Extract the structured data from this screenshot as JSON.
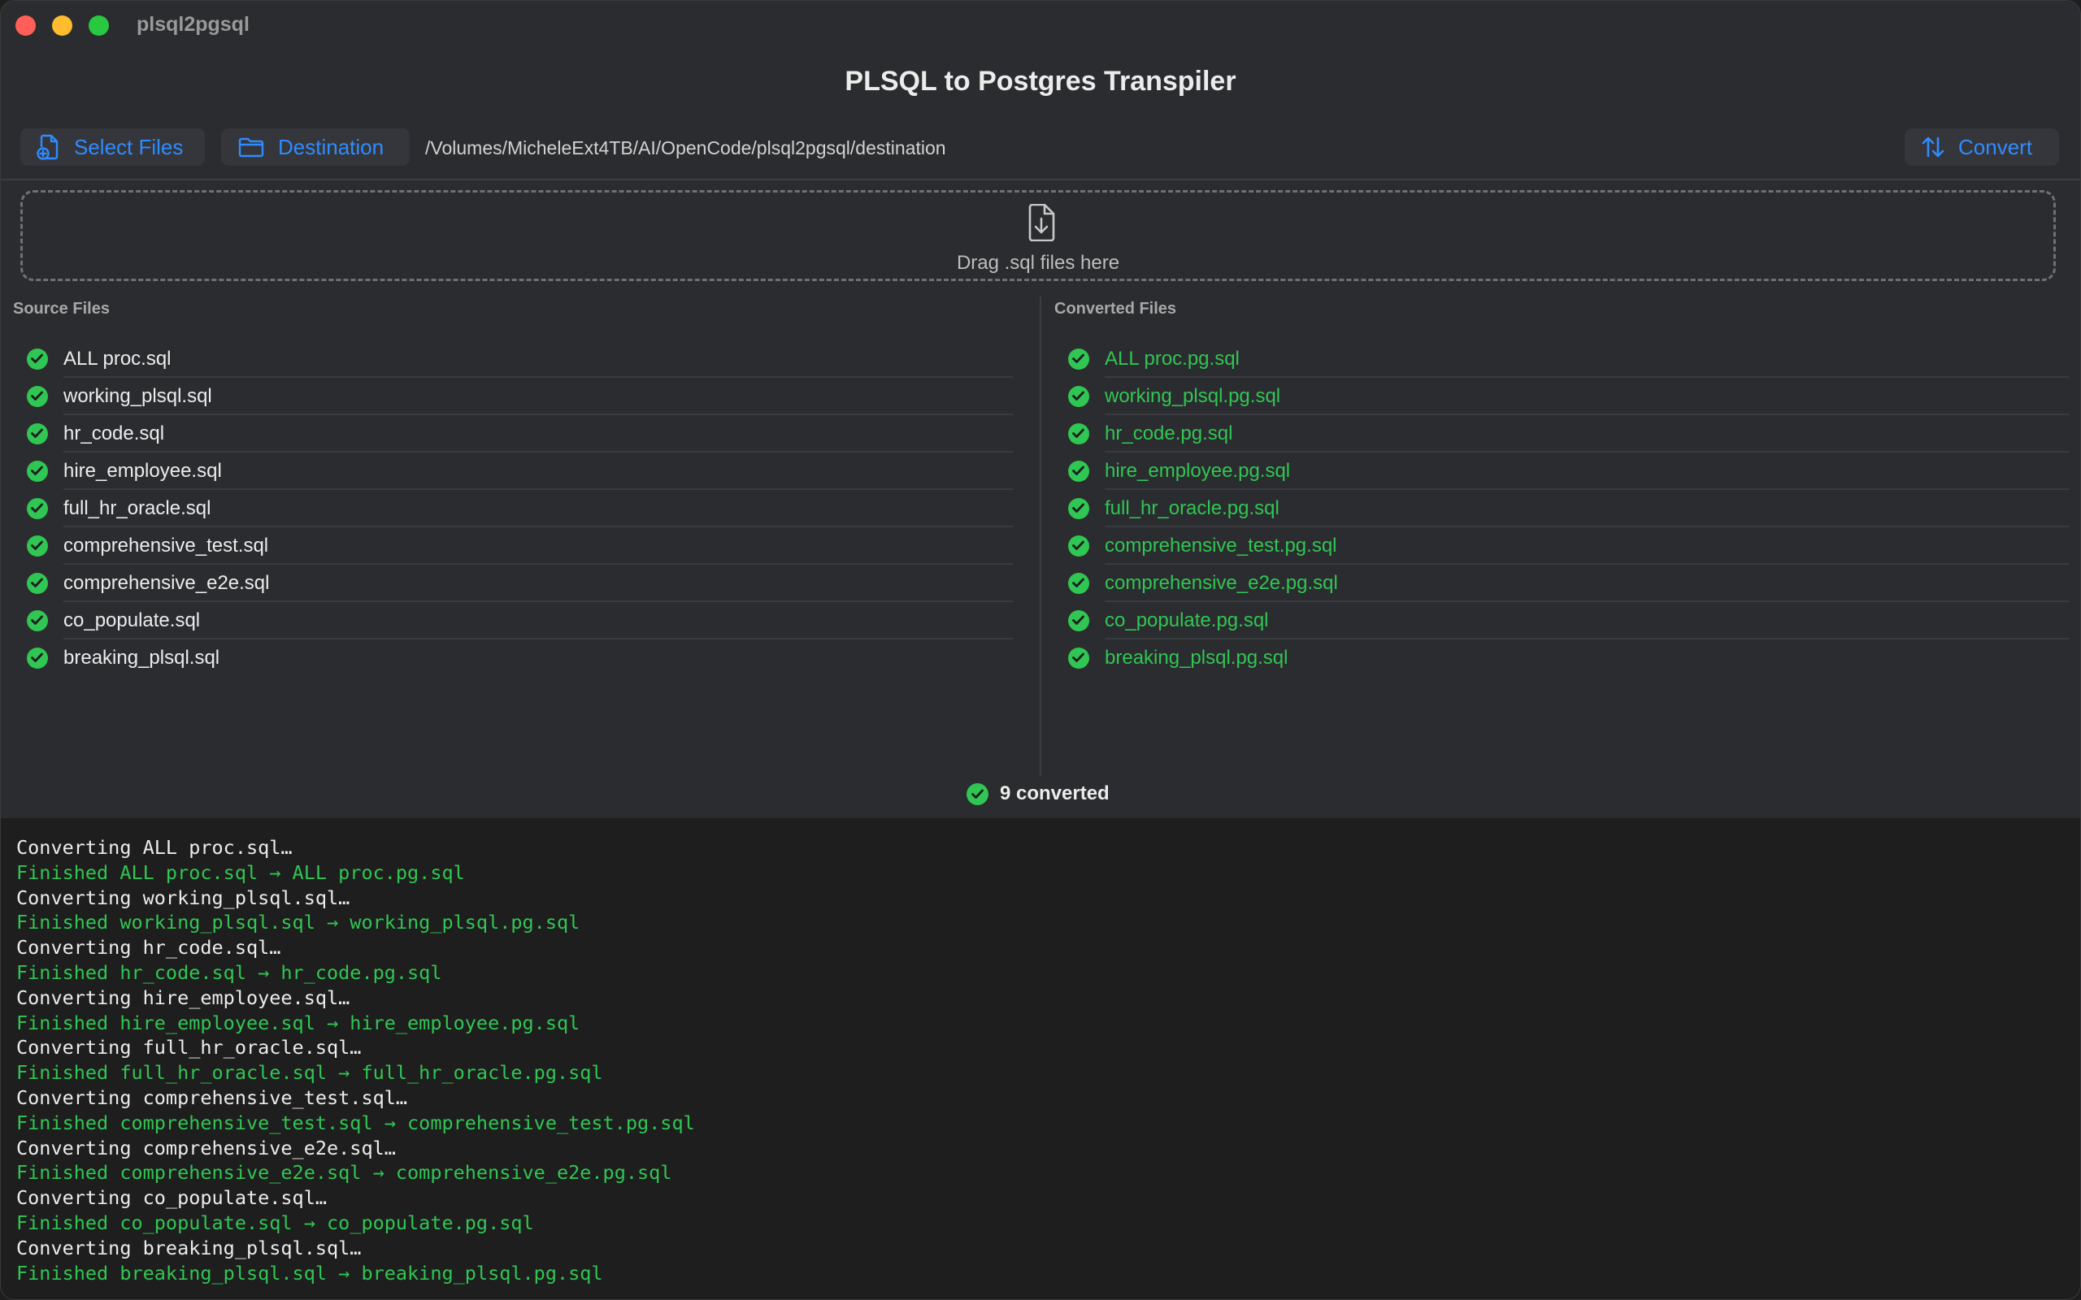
{
  "window": {
    "title": "plsql2pgsql"
  },
  "heading": "PLSQL to Postgres Transpiler",
  "toolbar": {
    "select_files_label": "Select Files",
    "destination_label": "Destination",
    "destination_path": "/Volumes/MicheleExt4TB/AI/OpenCode/plsql2pgsql/destination",
    "convert_label": "Convert"
  },
  "dropzone": {
    "label": "Drag .sql files here"
  },
  "source_panel": {
    "title": "Source Files",
    "files": [
      "ALL proc.sql",
      "working_plsql.sql",
      "hr_code.sql",
      "hire_employee.sql",
      "full_hr_oracle.sql",
      "comprehensive_test.sql",
      "comprehensive_e2e.sql",
      "co_populate.sql",
      "breaking_plsql.sql"
    ]
  },
  "converted_panel": {
    "title": "Converted Files",
    "files": [
      "ALL proc.pg.sql",
      "working_plsql.pg.sql",
      "hr_code.pg.sql",
      "hire_employee.pg.sql",
      "full_hr_oracle.pg.sql",
      "comprehensive_test.pg.sql",
      "comprehensive_e2e.pg.sql",
      "co_populate.pg.sql",
      "breaking_plsql.pg.sql"
    ]
  },
  "status": {
    "text": "9 converted"
  },
  "log": [
    "Converting ALL proc.sql…",
    "Finished ALL proc.sql → ALL proc.pg.sql",
    "Converting working_plsql.sql…",
    "Finished working_plsql.sql → working_plsql.pg.sql",
    "Converting hr_code.sql…",
    "Finished hr_code.sql → hr_code.pg.sql",
    "Converting hire_employee.sql…",
    "Finished hire_employee.sql → hire_employee.pg.sql",
    "Converting full_hr_oracle.sql…",
    "Finished full_hr_oracle.sql → full_hr_oracle.pg.sql",
    "Converting comprehensive_test.sql…",
    "Finished comprehensive_test.sql → comprehensive_test.pg.sql",
    "Converting comprehensive_e2e.sql…",
    "Finished comprehensive_e2e.sql → comprehensive_e2e.pg.sql",
    "Converting co_populate.sql…",
    "Finished co_populate.sql → co_populate.pg.sql",
    "Converting breaking_plsql.sql…",
    "Finished breaking_plsql.sql → breaking_plsql.pg.sql"
  ],
  "colors": {
    "accent": "#2f8cff",
    "success": "#30c653",
    "background": "#2b2c2f",
    "log_background": "#1e1e1e"
  },
  "icons": {
    "select_files": "document-plus-icon",
    "destination": "folder-icon",
    "convert": "arrows-up-down-icon",
    "dropzone": "document-download-icon",
    "file_status": "checkmark-circle-icon"
  }
}
